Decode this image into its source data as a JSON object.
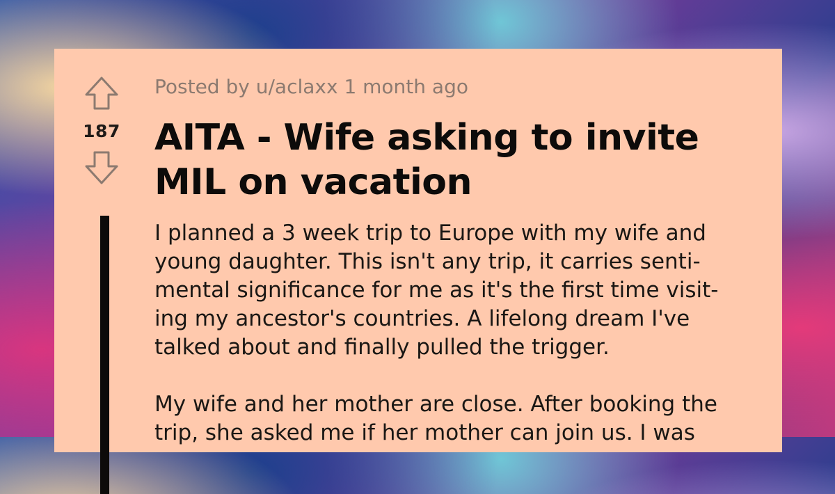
{
  "post": {
    "meta": "Posted by u/aclaxx 1 month ago",
    "score": "187",
    "title": "AITA - Wife asking to invite MIL on vacation",
    "paragraphs": [
      "I planned a 3 week trip to Europe with my wife and\nyoung daughter. This isn't any trip, it carries senti-\nmental significance for me as it's the first time visit-\ning my ancestor's countries. A lifelong dream I've\ntalked about and finally pulled the trigger.",
      "My wife and her mother are close. After booking the\ntrip, she asked me if her mother can join us. I was"
    ]
  },
  "icons": {
    "upvote": "arrow-up-icon",
    "downvote": "arrow-down-icon"
  },
  "colors": {
    "card": "#ffc9ad",
    "meta": "#8c7a70",
    "text": "#0d0b0a"
  }
}
